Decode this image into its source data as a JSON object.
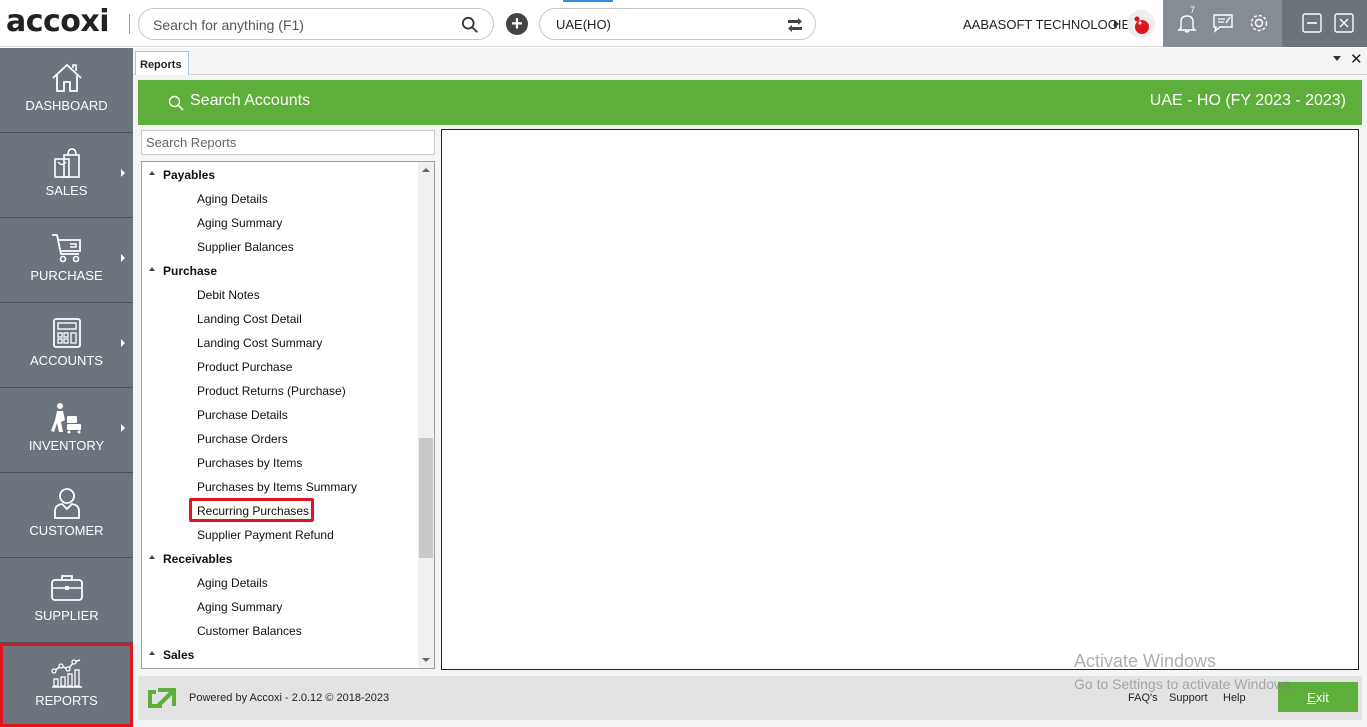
{
  "topbar": {
    "logo": "accoxi",
    "search_placeholder": "Search for anything (F1)",
    "add_label": "+",
    "branch": "UAE(HO)",
    "company": "AABASOFT TECHNOLOGIES",
    "notification_count": "7"
  },
  "sidebar": {
    "items": [
      {
        "label": "DASHBOARD",
        "icon": "home-icon"
      },
      {
        "label": "SALES",
        "icon": "shopping-bag-icon"
      },
      {
        "label": "PURCHASE",
        "icon": "cart-icon"
      },
      {
        "label": "ACCOUNTS",
        "icon": "calculator-icon"
      },
      {
        "label": "INVENTORY",
        "icon": "inventory-icon"
      },
      {
        "label": "CUSTOMER",
        "icon": "customer-icon"
      },
      {
        "label": "SUPPLIER",
        "icon": "briefcase-icon"
      },
      {
        "label": "REPORTS",
        "icon": "reports-chart-icon"
      }
    ],
    "active": "REPORTS"
  },
  "tab": {
    "label": "Reports"
  },
  "header": {
    "search_accounts": "Search Accounts",
    "company_period": "UAE - HO (FY 2023 - 2023)"
  },
  "reports": {
    "search_placeholder": "Search Reports",
    "tree": [
      {
        "type": "group",
        "label": "Payables"
      },
      {
        "type": "item",
        "label": "Aging Details"
      },
      {
        "type": "item",
        "label": "Aging Summary"
      },
      {
        "type": "item",
        "label": "Supplier Balances"
      },
      {
        "type": "group",
        "label": "Purchase"
      },
      {
        "type": "item",
        "label": "Debit Notes"
      },
      {
        "type": "item",
        "label": "Landing Cost Detail"
      },
      {
        "type": "item",
        "label": "Landing Cost Summary"
      },
      {
        "type": "item",
        "label": "Product Purchase"
      },
      {
        "type": "item",
        "label": "Product Returns (Purchase)"
      },
      {
        "type": "item",
        "label": "Purchase Details"
      },
      {
        "type": "item",
        "label": "Purchase Orders"
      },
      {
        "type": "item",
        "label": "Purchases by Items"
      },
      {
        "type": "item",
        "label": "Purchases by Items Summary"
      },
      {
        "type": "item",
        "label": "Recurring Purchases",
        "highlighted": true
      },
      {
        "type": "item",
        "label": "Supplier Payment Refund"
      },
      {
        "type": "group",
        "label": "Receivables"
      },
      {
        "type": "item",
        "label": "Aging Details"
      },
      {
        "type": "item",
        "label": "Aging Summary"
      },
      {
        "type": "item",
        "label": "Customer Balances"
      },
      {
        "type": "group",
        "label": "Sales"
      }
    ]
  },
  "footer": {
    "powered_by": "Powered by Accoxi - 2.0.12 © 2018-2023",
    "faqs": "FAQ's",
    "support": "Support",
    "help": "Help",
    "exit_first": "E",
    "exit_rest": "xit"
  },
  "watermark": {
    "line1": "Activate Windows",
    "line2": "Go to Settings to activate Windows."
  },
  "colors": {
    "accent_green": "#5dae3a",
    "sidebar_bg": "#6c757d",
    "highlight_red": "#e0161e"
  }
}
